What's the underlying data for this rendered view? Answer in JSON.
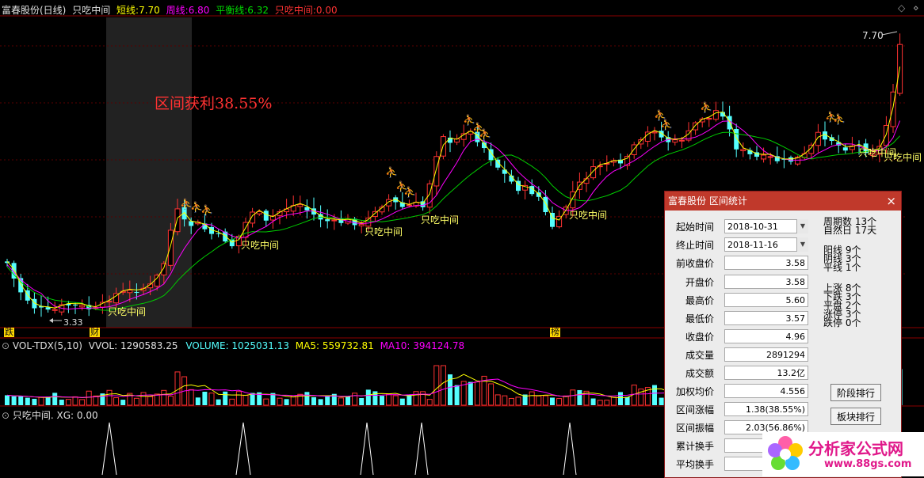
{
  "header": {
    "stock": "富春股份(日线)",
    "indicator": "只吃中间",
    "short_label": "短线:",
    "short_val": "7.70",
    "week_label": "周线:",
    "week_val": "6.80",
    "balance_label": "平衡线:",
    "balance_val": "6.32",
    "zczj_label": "只吃中间:",
    "zczj_val": "0.00"
  },
  "chart": {
    "interval_text": "区间获利38.55%",
    "high_label": "7.70",
    "low_label": "3.33",
    "signal_label": "只吃中间",
    "bottom_tags": [
      "跌",
      "财",
      "榜"
    ],
    "colors": {
      "up": "#ff3232",
      "down": "#54ffff",
      "short": "#ffff00",
      "week": "#ff00ff",
      "balance": "#00dd00"
    }
  },
  "volume": {
    "title": "VOL-TDX(5,10)",
    "vvol": "VVOL: 1290583.25",
    "volume": "VOLUME: 1025031.13",
    "ma5": "MA5: 559732.81",
    "ma10": "MA10: 394124.78"
  },
  "signal": {
    "title": "只吃中间. XG: 0.00"
  },
  "panel": {
    "title": "富春股份 区间统计",
    "close_icon": "×",
    "start_label": "起始时间",
    "start_val": "2018-10-31",
    "end_label": "终止时间",
    "end_val": "2018-11-16",
    "rows": [
      {
        "label": "前收盘价",
        "value": "3.58"
      },
      {
        "label": "开盘价",
        "value": "3.58"
      },
      {
        "label": "最高价",
        "value": "5.60"
      },
      {
        "label": "最低价",
        "value": "3.57"
      },
      {
        "label": "收盘价",
        "value": "4.96"
      },
      {
        "label": "成交量",
        "value": "2891294"
      },
      {
        "label": "成交额",
        "value": "13.2亿"
      },
      {
        "label": "加权均价",
        "value": "4.556"
      },
      {
        "label": "区间涨幅",
        "value": "1.38(38.55%)"
      },
      {
        "label": "区间振幅",
        "value": "2.03(56.86%)"
      },
      {
        "label": "累计换手",
        "value": ""
      },
      {
        "label": "平均换手",
        "value": ""
      }
    ],
    "stats1": [
      "周期数 13个",
      "自然日 17天"
    ],
    "stats2": [
      "阳线 9个",
      "阴线 3个",
      "平线 1个"
    ],
    "stats3": [
      "上涨 8个",
      "下跌 3个",
      "平盘 2个",
      "涨停 3个",
      "跌停 0个"
    ],
    "btn_stage": "阶段排行",
    "btn_sector": "板块排行"
  },
  "watermark": {
    "text": "分析家公式网",
    "url": "www.88gs.com"
  }
}
